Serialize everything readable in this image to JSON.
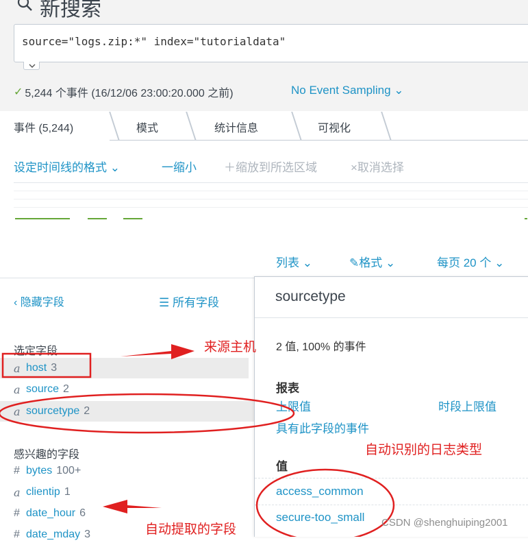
{
  "header": {
    "title": "新搜索",
    "query": "source=\"logs.zip:*\" index=\"tutorialdata\""
  },
  "status": {
    "events_text": "5,244 个事件 (16/12/06 23:00:20.000 之前)",
    "sampling_label": "No Event Sampling"
  },
  "tabs": [
    {
      "label": "事件 (5,244)"
    },
    {
      "label": "模式"
    },
    {
      "label": "统计信息"
    },
    {
      "label": "可视化"
    }
  ],
  "timeline": {
    "format_label": "设定时间线的格式",
    "zoom_out_label": "一缩小",
    "zoom_selection_label": "＋缩放到所选区域",
    "deselect_label": "×取消选择"
  },
  "results_controls": {
    "list_label": "列表",
    "format_label": "格式",
    "per_page_label": "每页 20 个"
  },
  "fields_panel": {
    "hide_fields_label": "隐藏字段",
    "all_fields_label": "所有字段",
    "selected_heading": "选定字段",
    "selected_fields": [
      {
        "type": "a",
        "name": "host",
        "count": "3"
      },
      {
        "type": "a",
        "name": "source",
        "count": "2"
      },
      {
        "type": "a",
        "name": "sourcetype",
        "count": "2"
      }
    ],
    "interesting_heading": "感兴趣的字段",
    "interesting_fields": [
      {
        "type": "#",
        "name": "bytes",
        "count": "100+"
      },
      {
        "type": "a",
        "name": "clientip",
        "count": "1"
      },
      {
        "type": "#",
        "name": "date_hour",
        "count": "6"
      },
      {
        "type": "#",
        "name": "date_mday",
        "count": "3"
      }
    ]
  },
  "field_popup": {
    "title": "sourcetype",
    "summary": "2 值, 100% 的事件",
    "reports_heading": "报表",
    "top_values_link": "上限值",
    "top_values_by_time_link": "时段上限值",
    "events_with_field_link": "具有此字段的事件",
    "values_heading": "值",
    "values": [
      {
        "label": "access_common"
      },
      {
        "label": "secure-too_small"
      }
    ]
  },
  "annotations": {
    "source_host": "来源主机",
    "log_type": "自动识别的日志类型",
    "auto_extracted": "自动提取的字段",
    "color": "#e02020"
  },
  "watermark": "CSDN @shenghuiping2001",
  "colors": {
    "link": "#1e93c6",
    "success": "#65a637",
    "annotation": "#e02020"
  }
}
